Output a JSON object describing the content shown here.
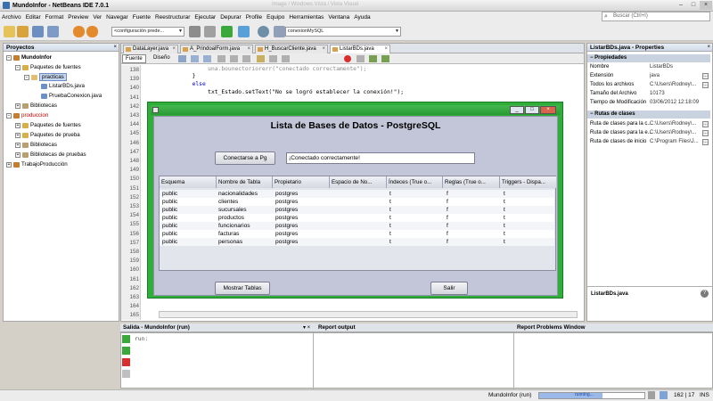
{
  "window": {
    "title": "MundoInfor - NetBeans IDE 7.0.1",
    "ghost_title": "Image / Windows Vista / Vista Visual",
    "controls": [
      "–",
      "□",
      "×"
    ]
  },
  "menu": [
    "Archivo",
    "Editar",
    "Format",
    "Preview",
    "Ver",
    "Navegar",
    "Fuente",
    "Reestructurar",
    "Ejecutar",
    "Depurar",
    "Profile",
    "Equipo",
    "Herramientas",
    "Ventana",
    "Ayuda"
  ],
  "search": {
    "placeholder": "Buscar (Ctrl+I)"
  },
  "toolbar": {
    "config_combo": "<configuración prede...",
    "connection_combo": "conexionMySQL"
  },
  "projects_panel": {
    "title": "Proyectos",
    "close": "×",
    "tree": [
      {
        "label": "MundoInfor",
        "bold": true
      },
      {
        "label": "Paquetes de fuentes"
      },
      {
        "label": "practicas",
        "selected": true
      },
      {
        "label": "ListarBDs.java"
      },
      {
        "label": "PruebaConexion.java"
      },
      {
        "label": "Bibliotecas"
      },
      {
        "label": "produccion",
        "red": true
      },
      {
        "label": "Paquetes de fuentes"
      },
      {
        "label": "Paquetes de prueba"
      },
      {
        "label": "Bibliotecas"
      },
      {
        "label": "Bibliotecas de pruebas"
      },
      {
        "label": "TrabajoProducción"
      }
    ]
  },
  "editor": {
    "tabs": [
      "DataLayer.java",
      "A_PrindoalForm.java",
      "H_BuscarCliente.java",
      "ListarBDs.java"
    ],
    "mode_tabs": [
      "Fuente",
      "Diseño"
    ],
    "line_numbers": [
      "138",
      "139",
      "140",
      "141",
      "142",
      "143",
      "144",
      "145",
      "146",
      "147",
      "148",
      "149",
      "150",
      "151",
      "152",
      "153",
      "154",
      "155",
      "156",
      "157",
      "158",
      "159",
      "160",
      "161",
      "162",
      "163",
      "164",
      "165"
    ],
    "code_lines": [
      "    una.bounectoriorerr(\"conectado correctamente\");",
      "  }",
      "  else",
      "    txt_Estado.setText(\"No se logró establecer la conexión!\");"
    ]
  },
  "dialog": {
    "title_buttons": [
      "_",
      "□",
      "×"
    ],
    "heading": "Lista de Bases de Datos - PostgreSQL",
    "connect_button": "Conectarse a Pg",
    "status_field": "¡Conectado correctamente!",
    "show_button": "Mostrar Tablas",
    "exit_button": "Salir",
    "columns": [
      "Esquema",
      "Nombre de Tabla",
      "Propietario",
      "Espacio de No...",
      "Índeces (True o...",
      "Reglas (True o...",
      "Triggers - Dispa..."
    ],
    "rows": [
      [
        "public",
        "nacionalidades",
        "postgres",
        "",
        "t",
        "f",
        "t"
      ],
      [
        "public",
        "clientes",
        "postgres",
        "",
        "t",
        "f",
        "t"
      ],
      [
        "public",
        "sucursales",
        "postgres",
        "",
        "t",
        "f",
        "t"
      ],
      [
        "public",
        "productos",
        "postgres",
        "",
        "t",
        "f",
        "t"
      ],
      [
        "public",
        "funcionarios",
        "postgres",
        "",
        "t",
        "f",
        "t"
      ],
      [
        "public",
        "facturas",
        "postgres",
        "",
        "t",
        "f",
        "t"
      ],
      [
        "public",
        "personas",
        "postgres",
        "",
        "t",
        "f",
        "t"
      ]
    ]
  },
  "properties_panel": {
    "title": "ListarBDs.java - Properties",
    "close": "×",
    "section1": "Propiedades",
    "rows1": [
      {
        "k": "Nombre",
        "v": "ListarBDs"
      },
      {
        "k": "Extensión",
        "v": "java"
      },
      {
        "k": "Todos los archivos",
        "v": "C:\\Users\\Rodney\\..."
      },
      {
        "k": "Tamaño del Archivo",
        "v": "10173"
      },
      {
        "k": "Tiempo de Modificación",
        "v": "03/06/2012 12:18:09"
      }
    ],
    "section2": "Rutas de clases",
    "rows2": [
      {
        "k": "Ruta de clases para la c...",
        "v": "C:\\Users\\Rodney\\..."
      },
      {
        "k": "Ruta de clases para la e...",
        "v": "C:\\Users\\Rodney\\..."
      },
      {
        "k": "Ruta de clases de inicio",
        "v": "C:\\Program Files\\J..."
      }
    ],
    "footer_label": "ListarBDs.java"
  },
  "bottom": {
    "output_tab": "Salida - MundoInfor (run)",
    "report_tab": "Report output",
    "problems_tab": "Report Problems Window",
    "output_line": "run:"
  },
  "status": {
    "run_label": "MundoInfor (run)",
    "progress_label": "running...",
    "position": "162 | 17",
    "mode": "INS"
  }
}
